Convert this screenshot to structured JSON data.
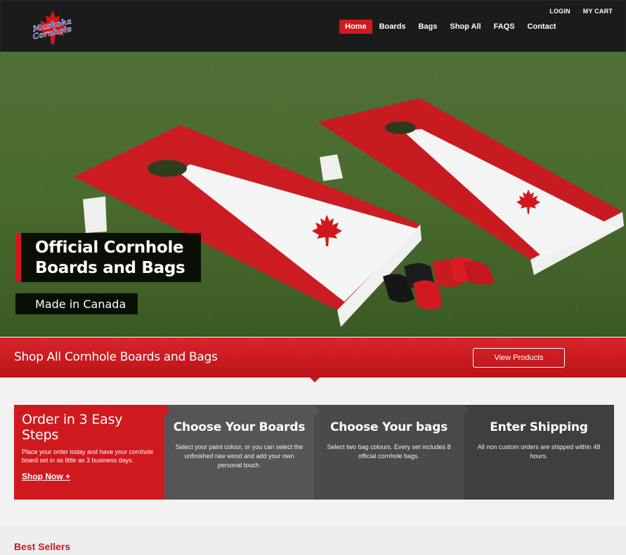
{
  "header": {
    "logo_text": "Muskoka Cornhole",
    "top_links": [
      "LOGIN",
      "MY CART"
    ],
    "nav": [
      "Home",
      "Boards",
      "Bags",
      "Shop All",
      "FAQS",
      "Contact"
    ],
    "active_nav": "Home"
  },
  "hero": {
    "title_line1": "Official Cornhole",
    "title_line2": "Boards and Bags",
    "subtitle": "Made in Canada"
  },
  "banner": {
    "text": "Shop All Cornhole Boards and Bags",
    "button": "View Products"
  },
  "steps": {
    "intro_title": "Order in 3 Easy Steps",
    "intro_text": "Place your order today and have your cornhole board set in as little as 3 business days.",
    "intro_link": "Shop Now +",
    "items": [
      {
        "title": "Choose Your Boards",
        "text": "Select your paint colour, or you can select the unfinished raw wood and add your own personal touch."
      },
      {
        "title": "Choose Your bags",
        "text": "Select two bag colours. Every set includes 8 official cornhole bags."
      },
      {
        "title": "Enter Shipping",
        "text": "All non custom orders are shipped within 48 hours."
      }
    ]
  },
  "best_sellers": {
    "title": "Best Sellers"
  },
  "colors": {
    "accent": "#d0191e",
    "header_bg": "#1b1b1b"
  }
}
